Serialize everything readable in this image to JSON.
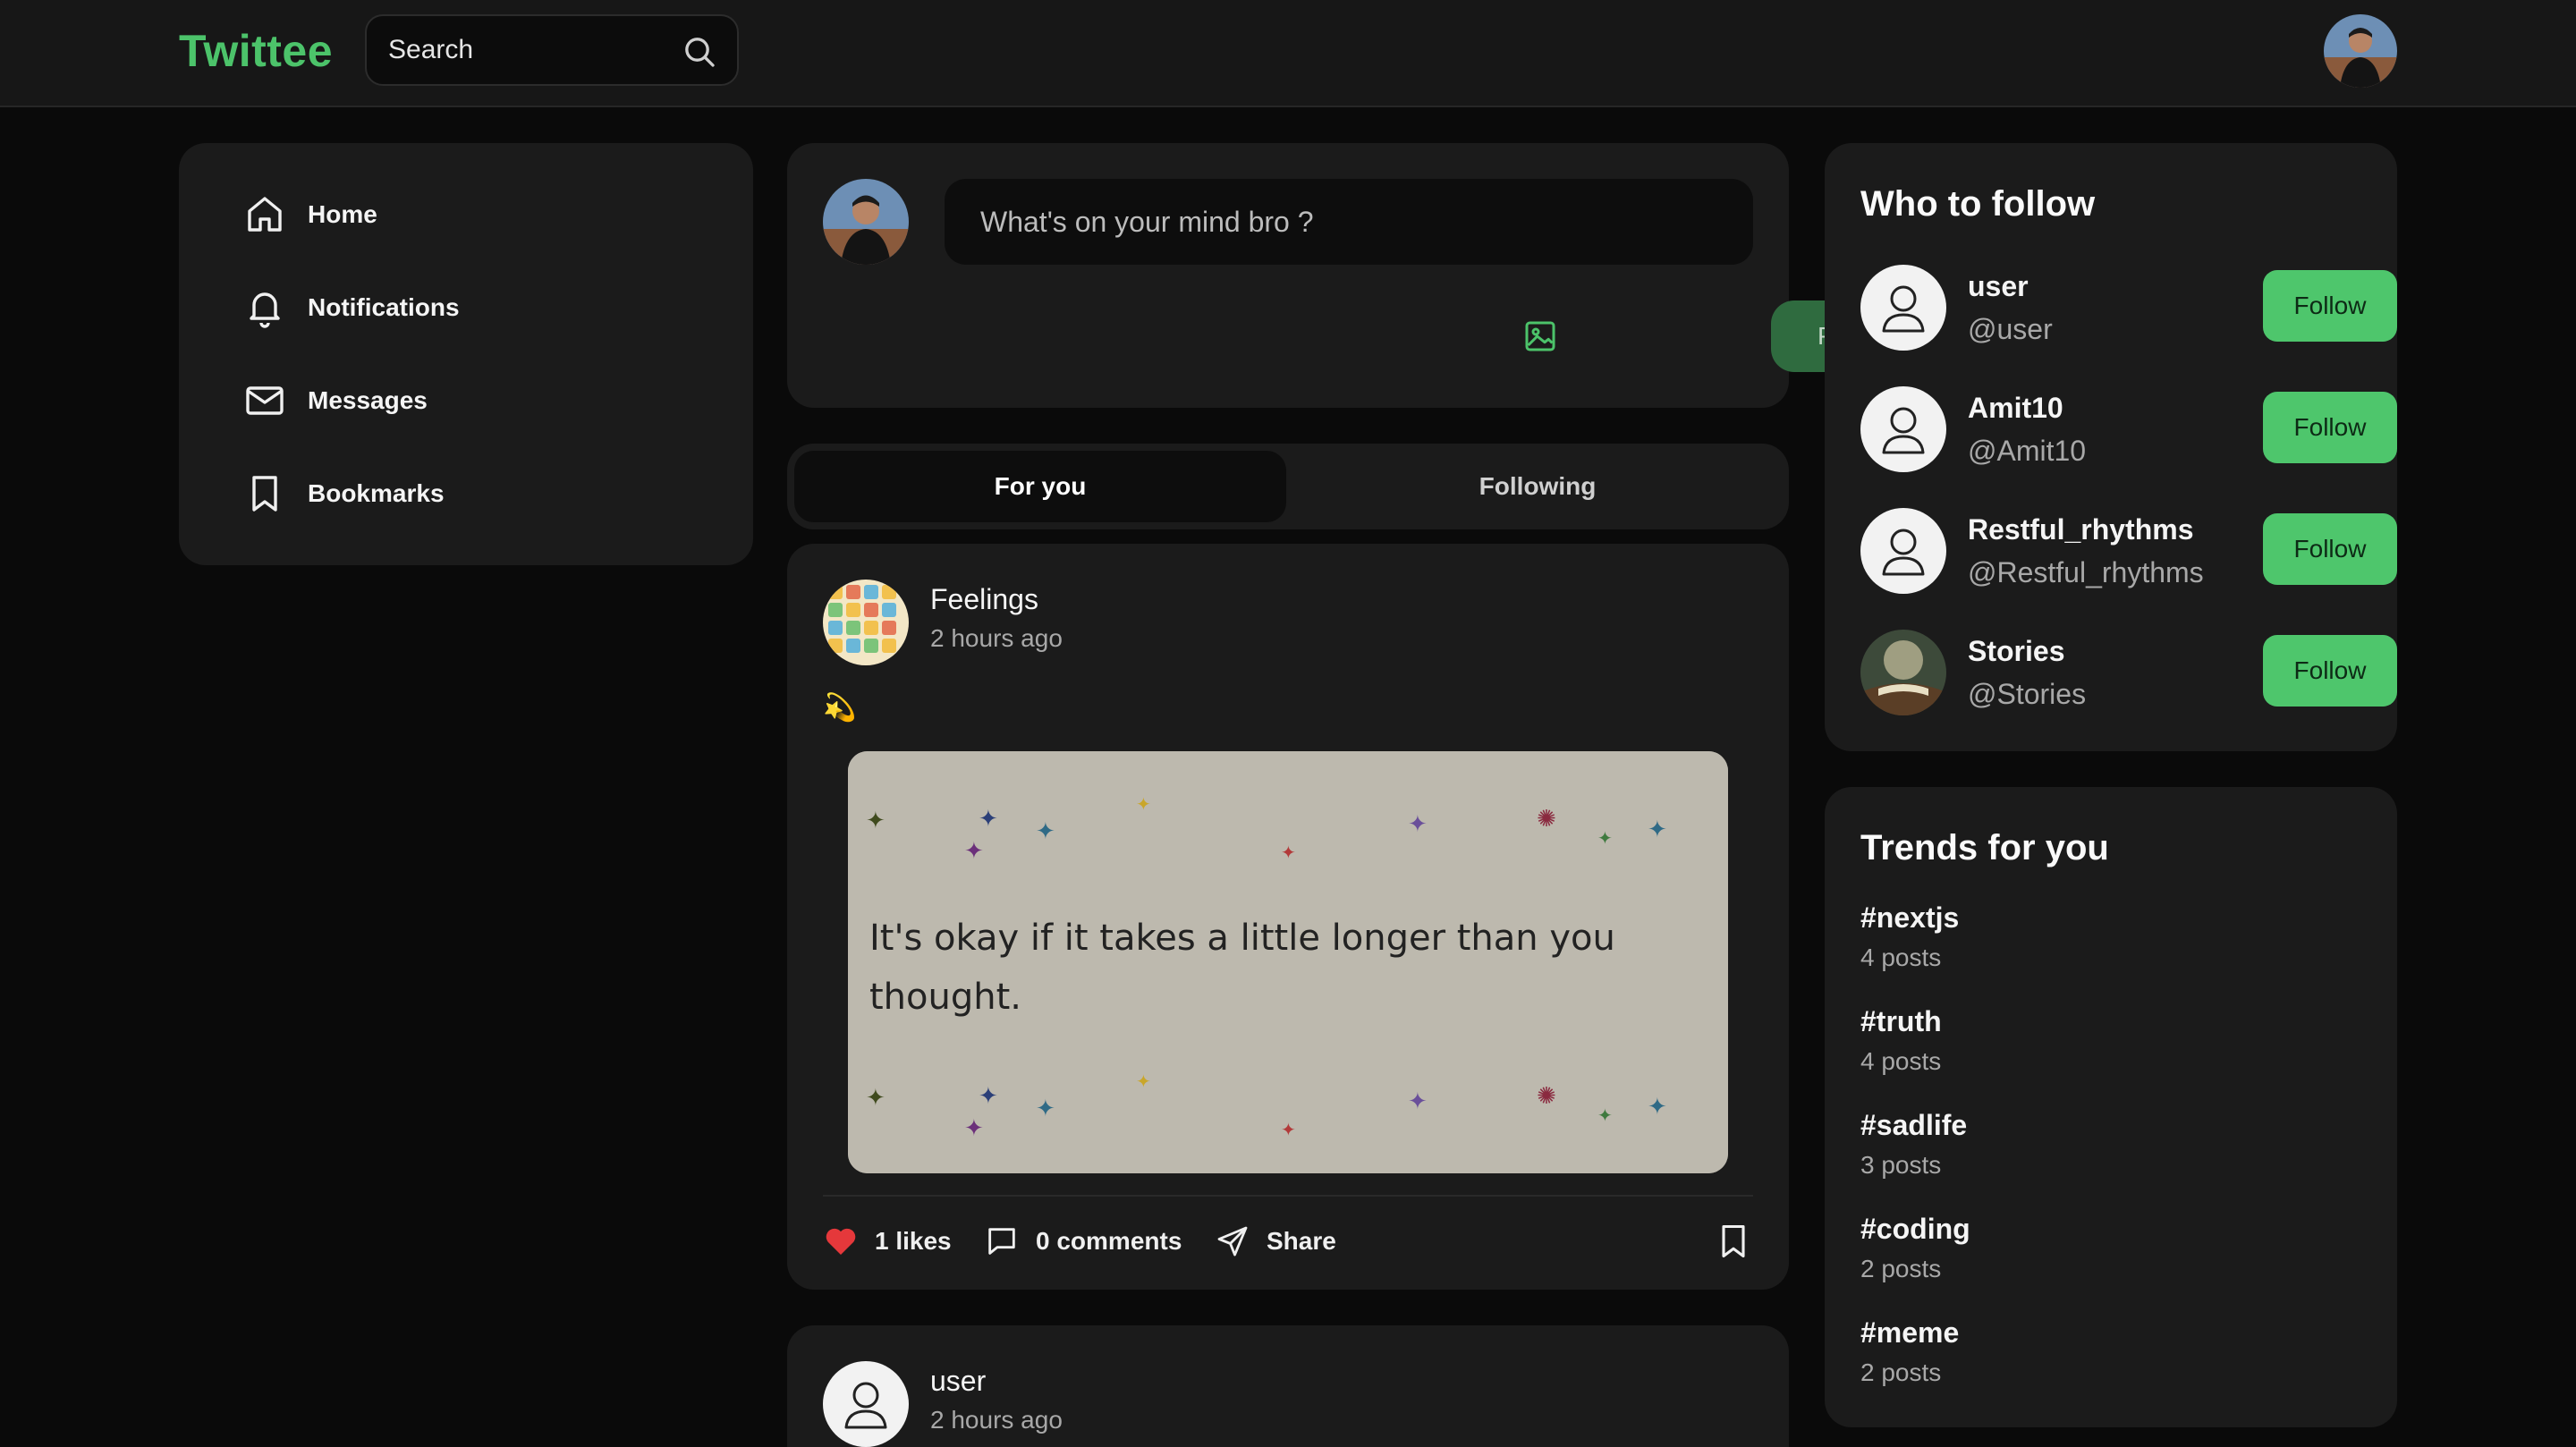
{
  "app": {
    "logo": "Twittee",
    "accent_color": "#4cc36a"
  },
  "search": {
    "placeholder": "Search"
  },
  "sidebar": {
    "items": [
      {
        "label": "Home",
        "icon": "home-icon"
      },
      {
        "label": "Notifications",
        "icon": "bell-icon"
      },
      {
        "label": "Messages",
        "icon": "mail-icon"
      },
      {
        "label": "Bookmarks",
        "icon": "bookmark-icon"
      }
    ]
  },
  "composer": {
    "placeholder": "What's on your mind bro ?",
    "post_label": "Post"
  },
  "tabs": [
    {
      "label": "For you",
      "active": true
    },
    {
      "label": "Following",
      "active": false
    }
  ],
  "posts": [
    {
      "author": "Feelings",
      "time": "2 hours ago",
      "emoji": "💫",
      "image_text": "It's okay if it takes a little longer than you thought.",
      "likes": "1 likes",
      "comments": "0 comments",
      "share": "Share"
    },
    {
      "author": "user",
      "time": "2 hours ago"
    }
  ],
  "who_to_follow": {
    "title": "Who to follow",
    "users": [
      {
        "name": "user",
        "handle": "@user",
        "button": "Follow"
      },
      {
        "name": "Amit10",
        "handle": "@Amit10",
        "button": "Follow"
      },
      {
        "name": "Restful_rhythms",
        "handle": "@Restful_rhythms",
        "button": "Follow"
      },
      {
        "name": "Stories",
        "handle": "@Stories",
        "button": "Follow"
      }
    ]
  },
  "trends": {
    "title": "Trends for you",
    "items": [
      {
        "tag": "#nextjs",
        "count": "4 posts"
      },
      {
        "tag": "#truth",
        "count": "4 posts"
      },
      {
        "tag": "#sadlife",
        "count": "3 posts"
      },
      {
        "tag": "#coding",
        "count": "2 posts"
      },
      {
        "tag": "#meme",
        "count": "2 posts"
      }
    ]
  }
}
